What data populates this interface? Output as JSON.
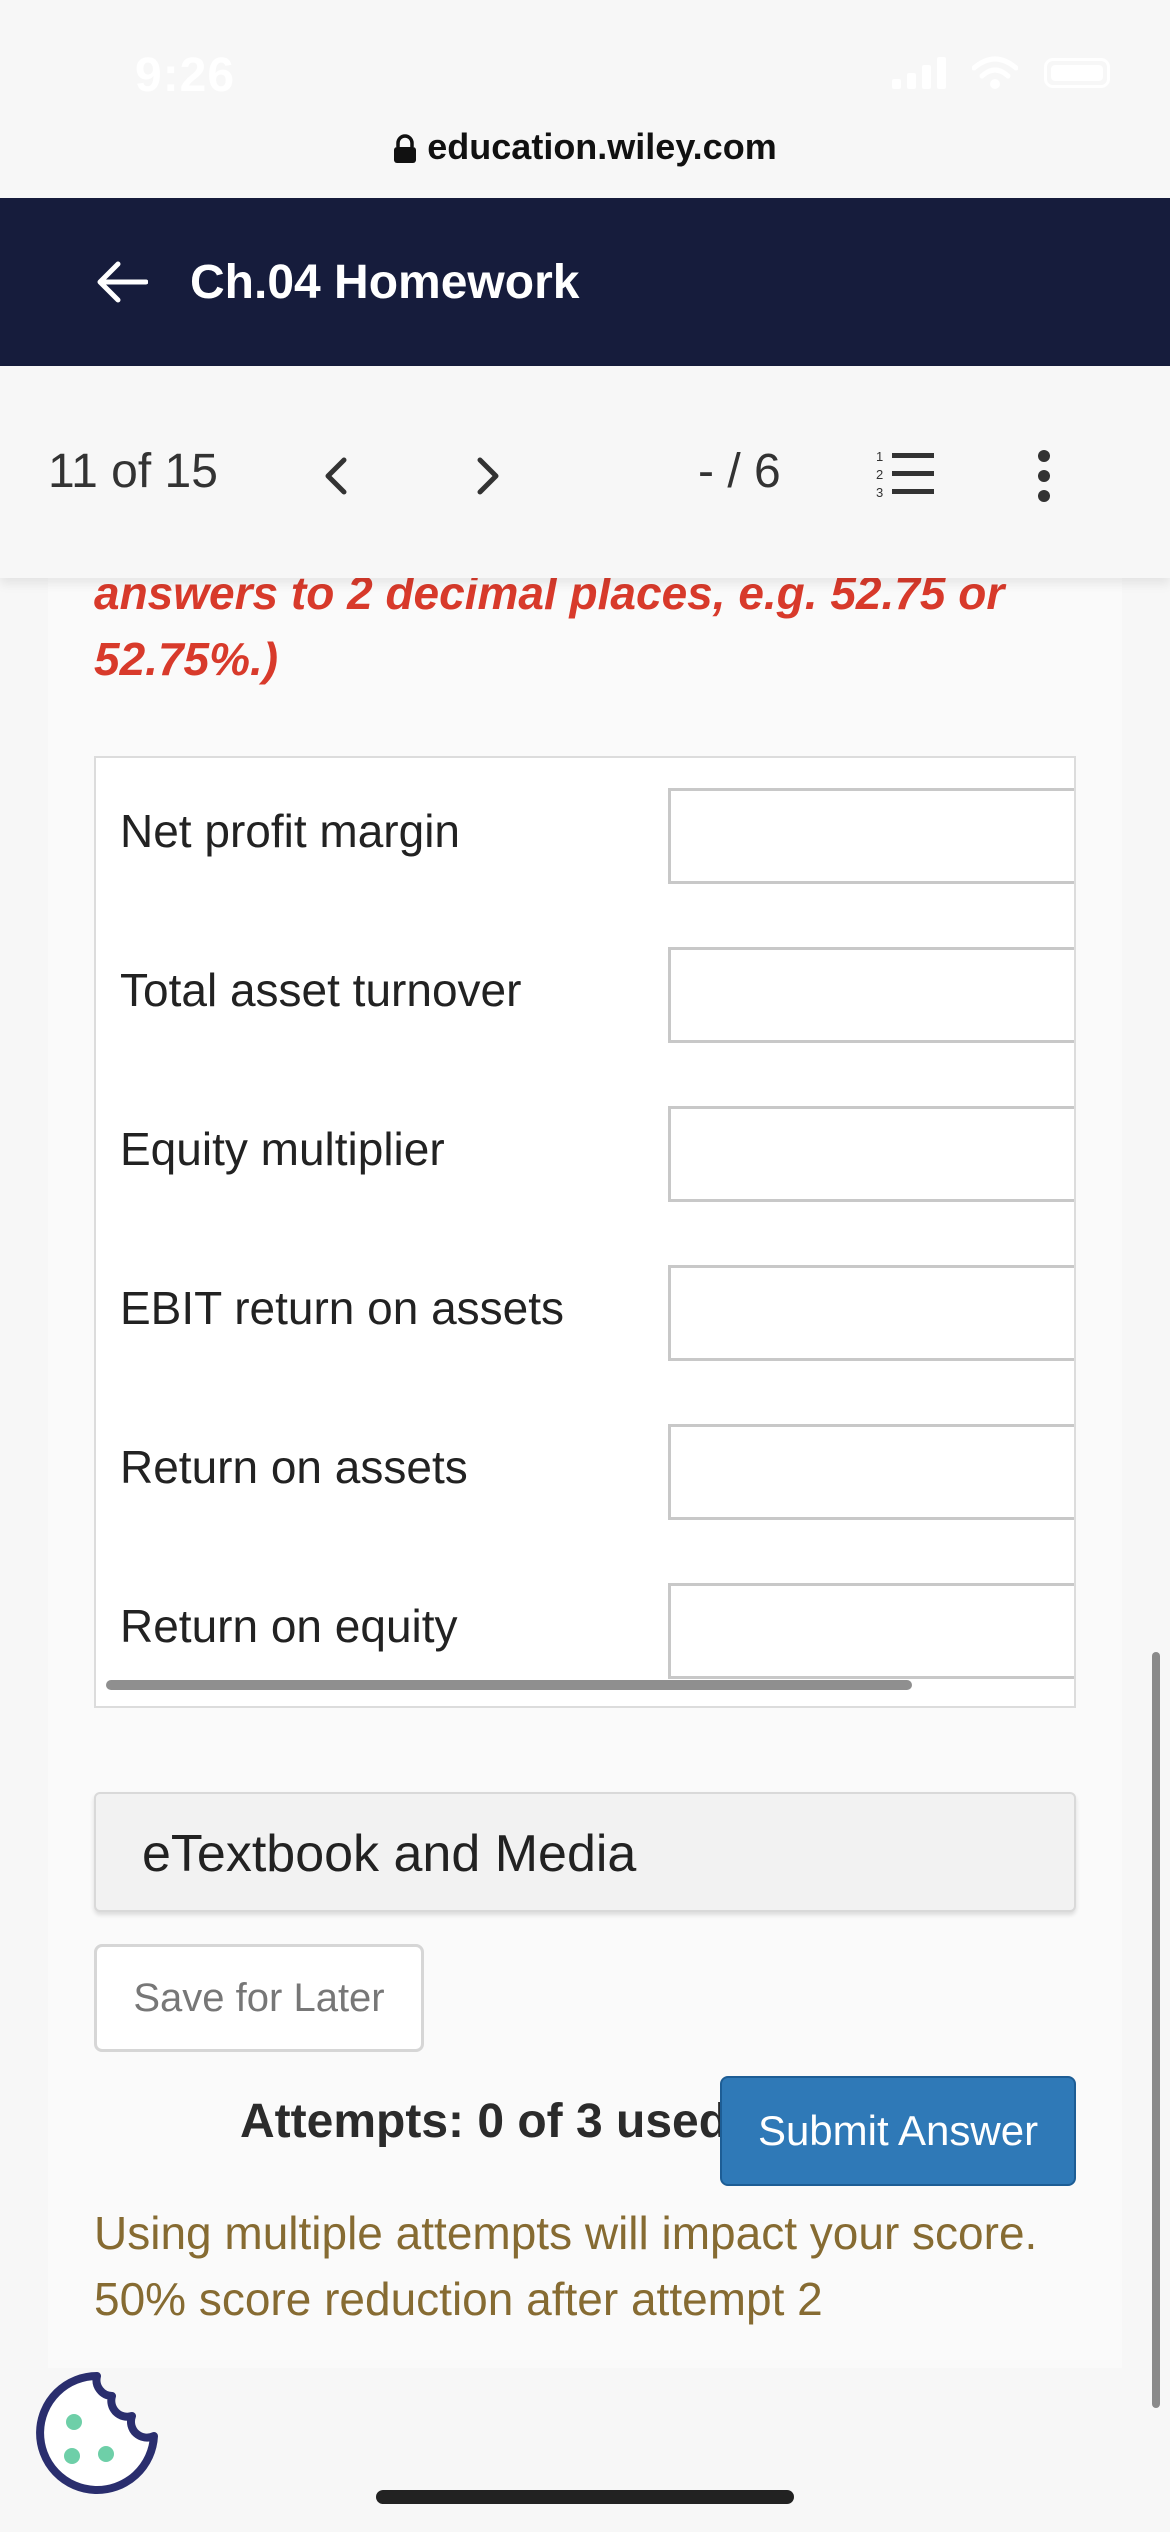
{
  "status": {
    "time": "9:26"
  },
  "browser": {
    "url": "education.wiley.com"
  },
  "header": {
    "title": "Ch.04 Homework"
  },
  "nav": {
    "position": "11 of 15",
    "score": "- / 6"
  },
  "instruction": "answers to 2 decimal places, e.g. 52.75 or 52.75%.)",
  "rows": [
    {
      "label": "Net profit margin",
      "value": ""
    },
    {
      "label": "Total asset turnover",
      "value": ""
    },
    {
      "label": "Equity multiplier",
      "value": ""
    },
    {
      "label": "EBIT return on assets",
      "value": ""
    },
    {
      "label": "Return on assets",
      "value": ""
    },
    {
      "label": "Return on equity",
      "value": ""
    }
  ],
  "media": {
    "label": "eTextbook and Media"
  },
  "actions": {
    "save_label": "Save for Later",
    "attempts": "Attempts: 0 of 3 used",
    "submit_label": "Submit Answer"
  },
  "warning": {
    "line1": "Using multiple attempts will impact your score.",
    "line2": "50% score reduction after attempt 2"
  },
  "colors": {
    "header_bg": "#161c3c",
    "instruction": "#d83a2b",
    "submit_bg": "#2f79b7",
    "warning": "#866b32",
    "cookie": "#2a2e6e",
    "cookie_dots": "#6ecfa8"
  }
}
